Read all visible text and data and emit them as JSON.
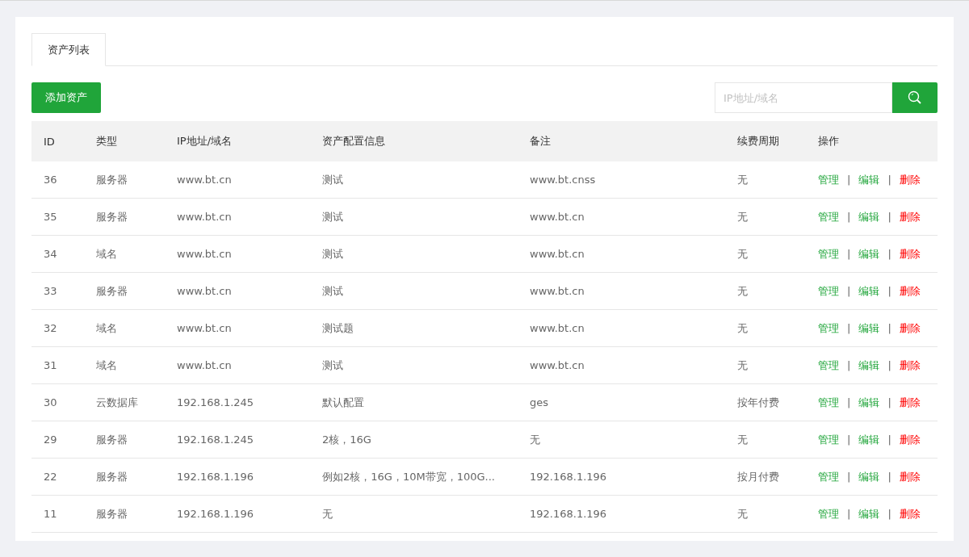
{
  "tabs": [
    {
      "label": "资产列表",
      "selected": true
    }
  ],
  "add_button": "添加资产",
  "search": {
    "placeholder": "IP地址/域名"
  },
  "table": {
    "columns": [
      "ID",
      "类型",
      "IP地址/域名",
      "资产配置信息",
      "备注",
      "续费周期",
      "操作"
    ],
    "rows": [
      {
        "cells": [
          "36",
          "服务器",
          "www.bt.cn",
          "测试",
          "www.bt.cnss",
          "无"
        ],
        "actions": [
          {
            "label": "管理",
            "kind": "manage"
          },
          {
            "label": "编辑",
            "kind": "edit"
          },
          {
            "label": "删除",
            "kind": "delete"
          }
        ],
        "separators": [
          "|",
          "|"
        ]
      },
      {
        "cells": [
          "35",
          "服务器",
          "www.bt.cn",
          "测试",
          "www.bt.cn",
          "无"
        ],
        "actions": [
          {
            "label": "管理",
            "kind": "manage"
          },
          {
            "label": "编辑",
            "kind": "edit"
          },
          {
            "label": "删除",
            "kind": "delete"
          }
        ],
        "separators": [
          "|",
          "|"
        ]
      },
      {
        "cells": [
          "34",
          "域名",
          "www.bt.cn",
          "测试",
          "www.bt.cn",
          "无"
        ],
        "actions": [
          {
            "label": "管理",
            "kind": "manage"
          },
          {
            "label": "编辑",
            "kind": "edit"
          },
          {
            "label": "删除",
            "kind": "delete"
          }
        ],
        "separators": [
          "|",
          "|"
        ]
      },
      {
        "cells": [
          "33",
          "服务器",
          "www.bt.cn",
          "测试",
          "www.bt.cn",
          "无"
        ],
        "actions": [
          {
            "label": "管理",
            "kind": "manage"
          },
          {
            "label": "编辑",
            "kind": "edit"
          },
          {
            "label": "删除",
            "kind": "delete"
          }
        ],
        "separators": [
          "|",
          "|"
        ]
      },
      {
        "cells": [
          "32",
          "域名",
          "www.bt.cn",
          "测试题",
          "www.bt.cn",
          "无"
        ],
        "actions": [
          {
            "label": "管理",
            "kind": "manage"
          },
          {
            "label": "编辑",
            "kind": "edit"
          },
          {
            "label": "删除",
            "kind": "delete"
          }
        ],
        "separators": [
          "|",
          "|"
        ]
      },
      {
        "cells": [
          "31",
          "域名",
          "www.bt.cn",
          "测试",
          "www.bt.cn",
          "无"
        ],
        "actions": [
          {
            "label": "管理",
            "kind": "manage"
          },
          {
            "label": "编辑",
            "kind": "edit"
          },
          {
            "label": "删除",
            "kind": "delete"
          }
        ],
        "separators": [
          "|",
          "|"
        ]
      },
      {
        "cells": [
          "30",
          "云数据库",
          "192.168.1.245",
          "默认配置",
          "ges",
          "按年付费"
        ],
        "actions": [
          {
            "label": "管理",
            "kind": "manage"
          },
          {
            "label": "编辑",
            "kind": "edit"
          },
          {
            "label": "删除",
            "kind": "delete"
          }
        ],
        "separators": [
          "|",
          "|"
        ]
      },
      {
        "cells": [
          "29",
          "服务器",
          "192.168.1.245",
          "2核，16G",
          "无",
          "无"
        ],
        "actions": [
          {
            "label": "管理",
            "kind": "manage"
          },
          {
            "label": "编辑",
            "kind": "edit"
          },
          {
            "label": "删除",
            "kind": "delete"
          }
        ],
        "separators": [
          "|",
          "|"
        ]
      },
      {
        "cells": [
          "22",
          "服务器",
          "192.168.1.196",
          "例如2核，16G，10M带宽，100G...",
          "192.168.1.196",
          "按月付费"
        ],
        "actions": [
          {
            "label": "管理",
            "kind": "manage"
          },
          {
            "label": "编辑",
            "kind": "edit"
          },
          {
            "label": "删除",
            "kind": "delete"
          }
        ],
        "separators": [
          "|",
          "|"
        ]
      },
      {
        "cells": [
          "11",
          "服务器",
          "192.168.1.196",
          "无",
          "192.168.1.196",
          "无"
        ],
        "actions": [
          {
            "label": "管理",
            "kind": "manage"
          },
          {
            "label": "编辑",
            "kind": "edit"
          },
          {
            "label": "删除",
            "kind": "delete"
          }
        ],
        "separators": [
          "|",
          "|"
        ]
      }
    ]
  }
}
